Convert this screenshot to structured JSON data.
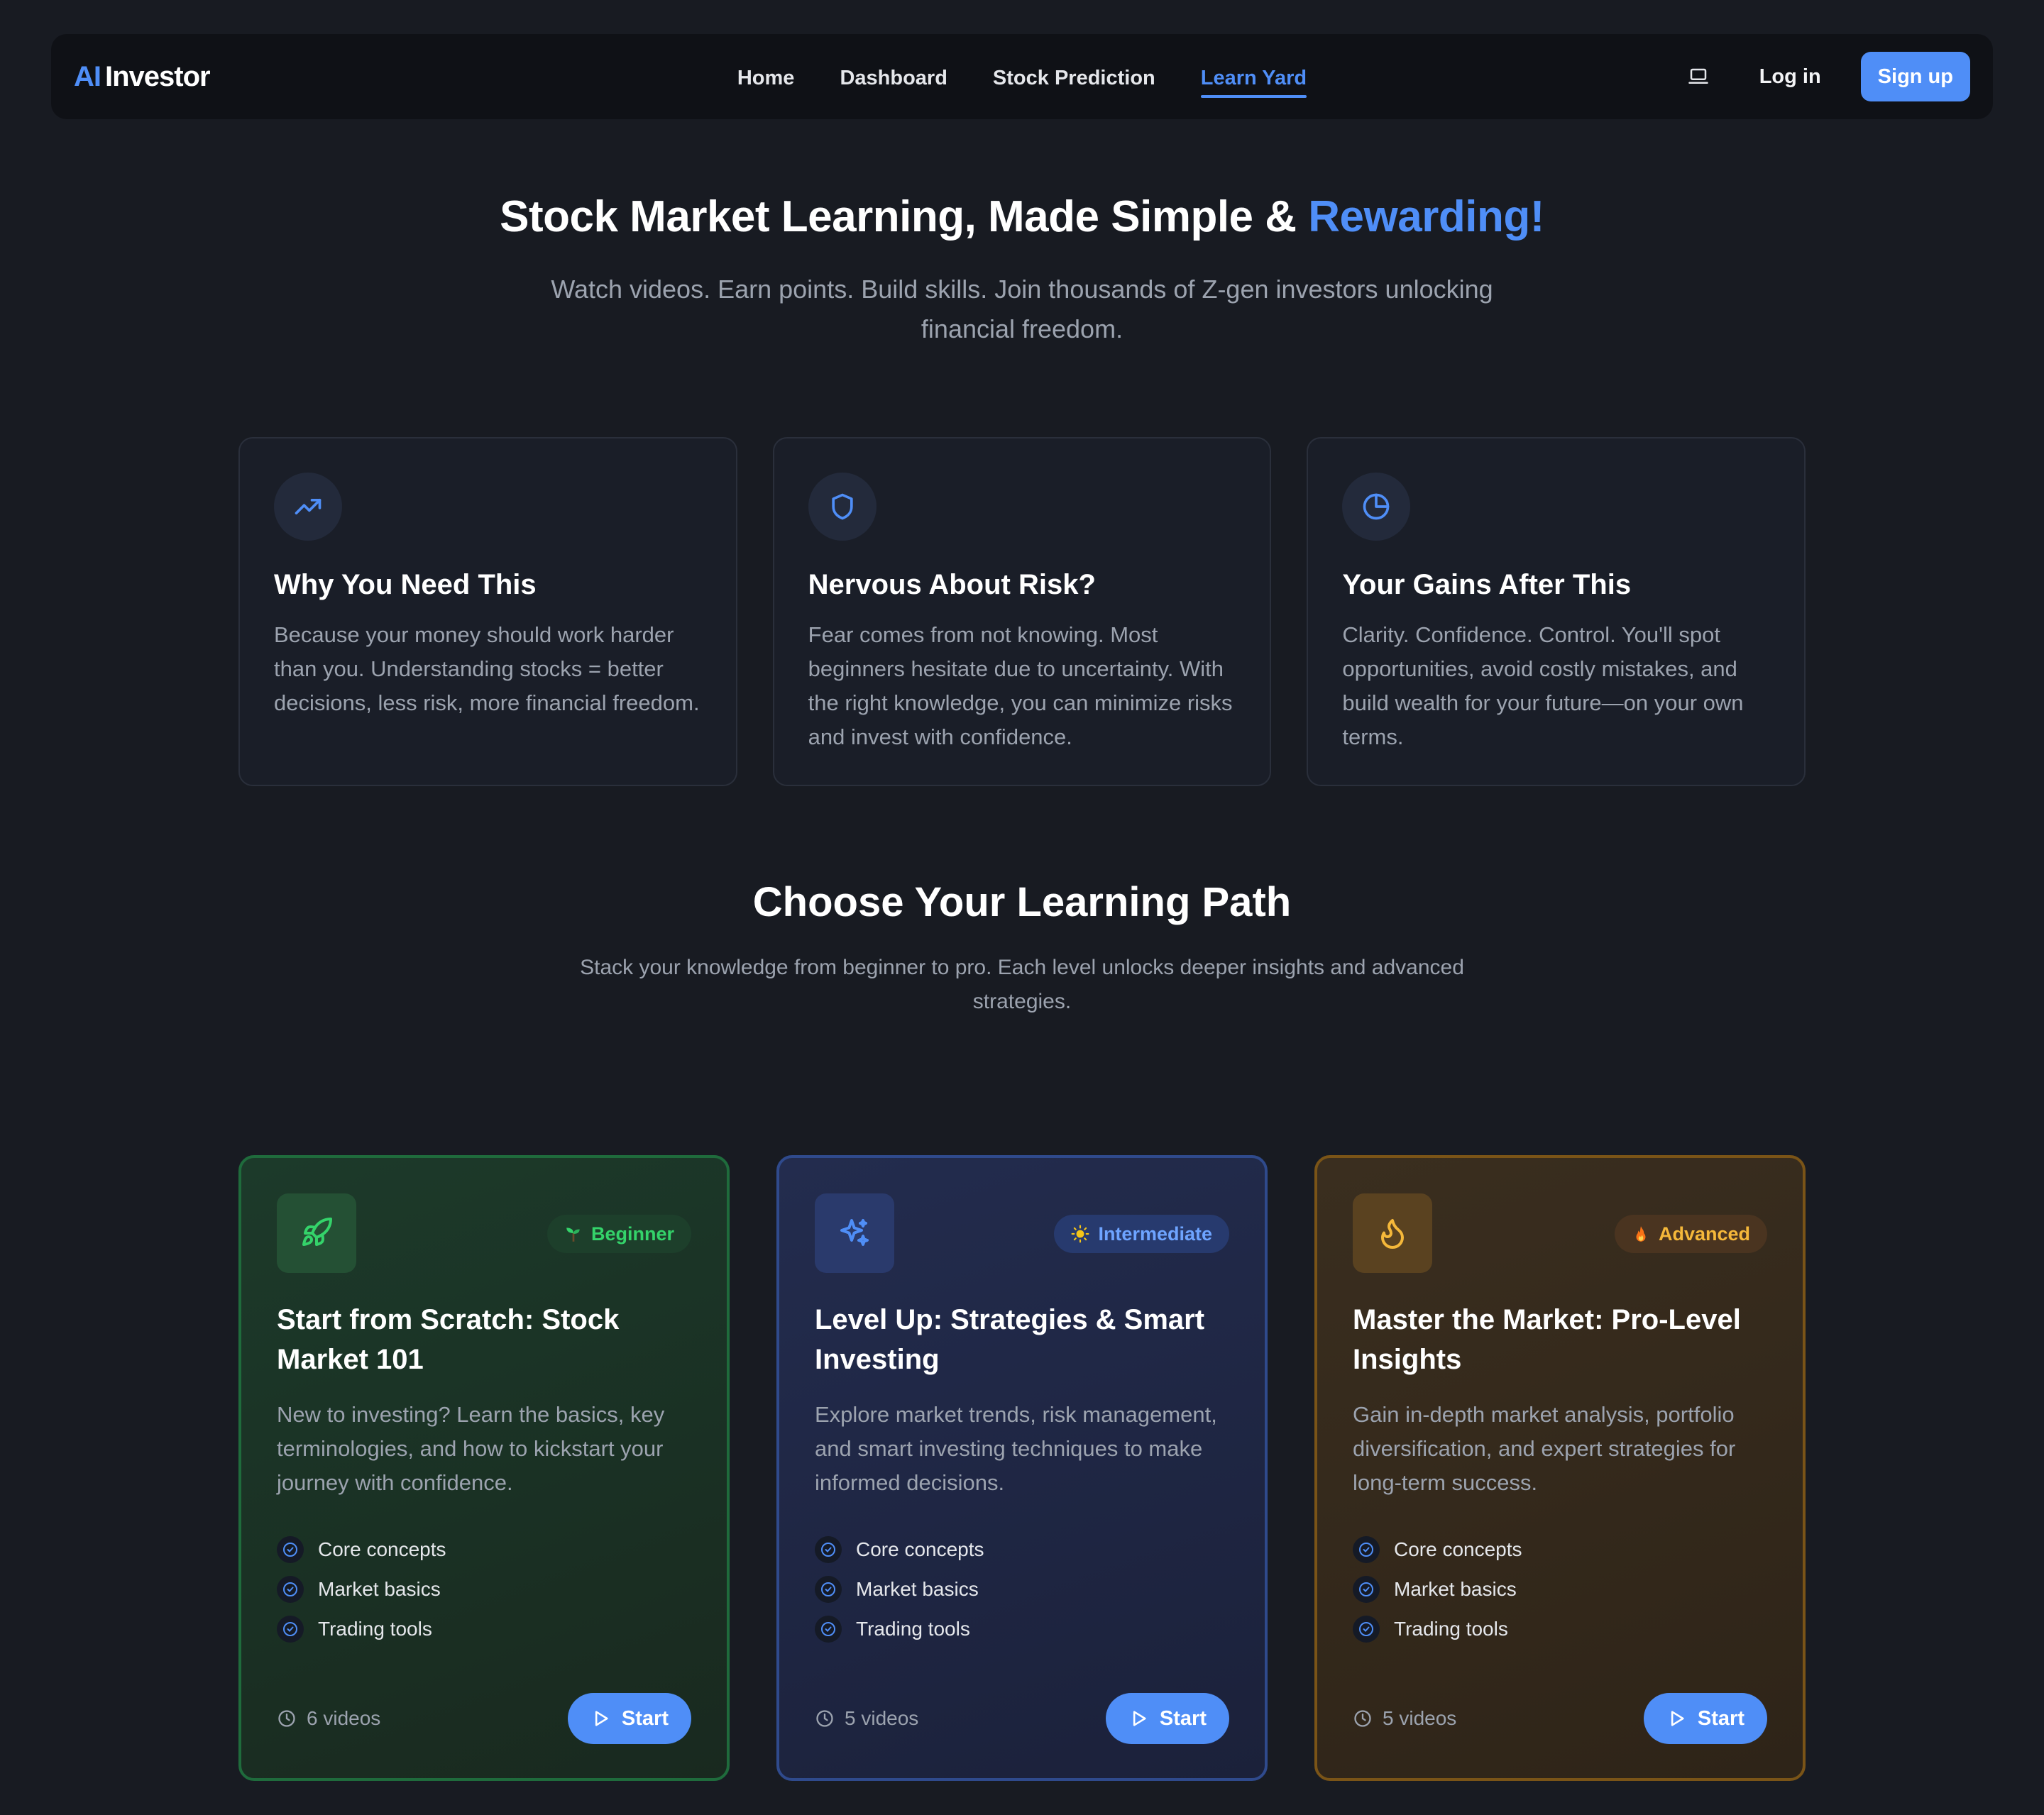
{
  "nav": {
    "logo_ai": "AI",
    "logo_rest": "Investor",
    "links": [
      "Home",
      "Dashboard",
      "Stock Prediction",
      "Learn Yard"
    ],
    "active_link": "Learn Yard",
    "login": "Log in",
    "signup": "Sign up"
  },
  "hero": {
    "title_main": "Stock Market Learning, Made Simple & ",
    "title_accent": "Rewarding!",
    "subtitle": "Watch videos. Earn points. Build skills. Join thousands of Z-gen investors unlocking financial freedom."
  },
  "features": [
    {
      "icon": "trending-up-icon",
      "title": "Why You Need This",
      "text": "Because your money should work harder than you. Understanding stocks = better decisions, less risk, more financial freedom."
    },
    {
      "icon": "shield-icon",
      "title": "Nervous About Risk?",
      "text": "Fear comes from not knowing. Most beginners hesitate due to uncertainty. With the right knowledge, you can minimize risks and invest with confidence."
    },
    {
      "icon": "pie-chart-icon",
      "title": "Your Gains After This",
      "text": "Clarity. Confidence. Control. You'll spot opportunities, avoid costly mistakes, and build wealth for your future—on your own terms."
    }
  ],
  "path": {
    "title": "Choose Your Learning Path",
    "subtitle": "Stack your knowledge from beginner to pro. Each level unlocks deeper insights and advanced strategies."
  },
  "levels": [
    {
      "theme": "green",
      "icon": "rocket-icon",
      "badge_icon": "sprout-icon",
      "badge": "Beginner",
      "title": "Start from Scratch: Stock Market 101",
      "text": "New to investing? Learn the basics, key terminologies, and how to kickstart your journey with confidence.",
      "items": [
        "Core concepts",
        "Market basics",
        "Trading tools"
      ],
      "videos": "6 videos",
      "button": "Start"
    },
    {
      "theme": "blue",
      "icon": "sparkles-icon",
      "badge_icon": "sun-icon",
      "badge": "Intermediate",
      "title": "Level Up: Strategies & Smart Investing",
      "text": "Explore market trends, risk management, and smart investing techniques to make informed decisions.",
      "items": [
        "Core concepts",
        "Market basics",
        "Trading tools"
      ],
      "videos": "5 videos",
      "button": "Start"
    },
    {
      "theme": "orange",
      "icon": "flame-icon",
      "badge_icon": "fire-icon",
      "badge": "Advanced",
      "title": "Master the Market: Pro-Level Insights",
      "text": "Gain in-depth market analysis, portfolio diversification, and expert strategies for long-term success.",
      "items": [
        "Core concepts",
        "Market basics",
        "Trading tools"
      ],
      "videos": "5 videos",
      "button": "Start"
    }
  ],
  "colors": {
    "accent": "#4f8ef7",
    "background": "#181b22",
    "green": "#34d36a",
    "orange": "#f5b83a"
  }
}
